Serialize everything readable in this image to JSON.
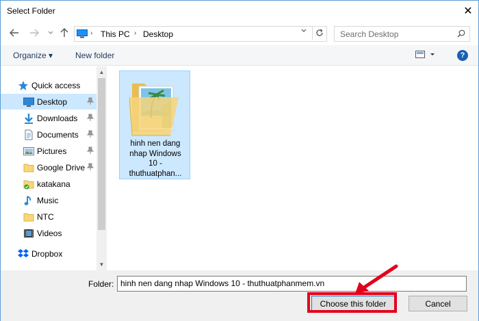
{
  "window": {
    "title": "Select Folder"
  },
  "address": {
    "crumbs": [
      "This PC",
      "Desktop"
    ]
  },
  "search": {
    "placeholder": "Search Desktop"
  },
  "toolbar": {
    "organize": "Organize ▾",
    "new_folder": "New folder",
    "help": "?"
  },
  "sidebar": {
    "quick_access": "Quick access",
    "items": [
      {
        "label": "Desktop",
        "icon": "desktop-icon",
        "pinned": true,
        "selected": true
      },
      {
        "label": "Downloads",
        "icon": "download-icon",
        "pinned": true
      },
      {
        "label": "Documents",
        "icon": "document-icon",
        "pinned": true
      },
      {
        "label": "Pictures",
        "icon": "pictures-icon",
        "pinned": true
      },
      {
        "label": "Google Drive",
        "icon": "folder-icon",
        "pinned": true
      },
      {
        "label": "katakana",
        "icon": "folder-sync-icon"
      },
      {
        "label": "Music",
        "icon": "music-icon"
      },
      {
        "label": "NTC",
        "icon": "folder-icon"
      },
      {
        "label": "Videos",
        "icon": "video-icon"
      }
    ],
    "dropbox": "Dropbox"
  },
  "content": {
    "items": [
      {
        "name_lines": [
          "hinh nen dang",
          "nhap Windows",
          "10 -",
          "thuthuatphan..."
        ]
      }
    ]
  },
  "footer": {
    "folder_label": "Folder:",
    "folder_value": "hinh nen dang nhap Windows 10 - thuthuatphanmem.vn",
    "choose_button": "Choose this folder",
    "cancel_button": "Cancel"
  },
  "colors": {
    "accent": "#0078d7",
    "selection": "#cce8ff",
    "annotation": "#e3001b"
  }
}
